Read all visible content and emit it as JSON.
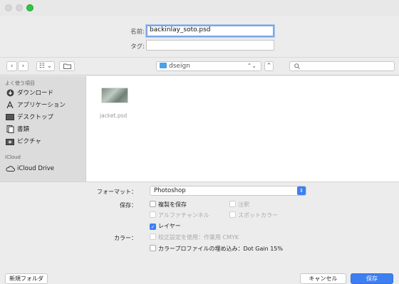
{
  "save_as": {
    "label": "名前:",
    "value": "backinlay_soto.psd"
  },
  "tags": {
    "label": "タグ:",
    "value": ""
  },
  "toolbar": {
    "back": "‹",
    "forward": "›",
    "view": "☷ ⌄",
    "location": "dseign",
    "search_placeholder": ""
  },
  "sidebar": {
    "favorites_heading": "よく使う項目",
    "favorites": [
      {
        "label": "ダウンロード",
        "icon": "download-icon"
      },
      {
        "label": "アプリケーション",
        "icon": "applications-icon"
      },
      {
        "label": "デスクトップ",
        "icon": "desktop-icon"
      },
      {
        "label": "書類",
        "icon": "documents-icon"
      },
      {
        "label": "ピクチャ",
        "icon": "pictures-icon"
      }
    ],
    "icloud_heading": "iCloud",
    "icloud": [
      {
        "label": "iCloud Drive",
        "icon": "cloud-icon"
      }
    ]
  },
  "files": [
    {
      "name": "jacket.psd"
    }
  ],
  "options": {
    "format_label": "フォーマット：",
    "format_value": "Photoshop",
    "save_label": "保存：",
    "as_copy": "複製を保存",
    "notes": "注釈",
    "alpha": "アルファチャンネル",
    "spot": "スポットカラー",
    "layers": "レイヤー",
    "color_label": "カラー：",
    "proof": "校正設定を使用：作業用 CMYK",
    "embed_profile": "カラープロファイルの埋め込み：Dot Gain 15%"
  },
  "buttons": {
    "new_folder": "新規フォルダ",
    "cancel": "キャンセル",
    "save": "保存"
  },
  "colors": {
    "accent": "#3d7ff0",
    "sidebar": "#dcdcdc"
  }
}
